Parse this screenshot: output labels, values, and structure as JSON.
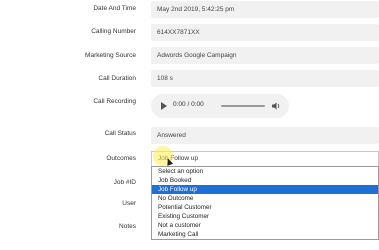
{
  "form": {
    "date_label": "Date And Time",
    "date_value": "May 2nd 2019, 5:42:25 pm",
    "calling_label": "Calling Number",
    "calling_value": "614XX7871XX",
    "source_label": "Marketing Source",
    "source_value": "Adwords Google Campaign",
    "duration_label": "Call Duration",
    "duration_value": "108 s",
    "recording_label": "Call Recording",
    "player_time": "0:00 / 0:00",
    "status_label": "Call Status",
    "status_value": "Answered",
    "outcomes_label": "Outcomes",
    "outcomes_value": "Job Follow up",
    "job_label": "Job #ID",
    "user_label": "User",
    "notes_label": "Notes"
  },
  "dropdown": {
    "options": [
      "Select an option",
      "Job Booked",
      "Job Follow up",
      "No Outcome",
      "Potential Customer",
      "Existing Customer",
      "Not a customer",
      "Marketing Call"
    ],
    "selected": "Job Follow up"
  },
  "icons": {
    "play": "play-icon",
    "volume": "volume-icon",
    "cursor": "mouse-pointer-icon"
  },
  "colors": {
    "field_bg": "#f1f1f1",
    "selected_option": "#1e6fd6",
    "cursor_highlight": "#fff050"
  }
}
